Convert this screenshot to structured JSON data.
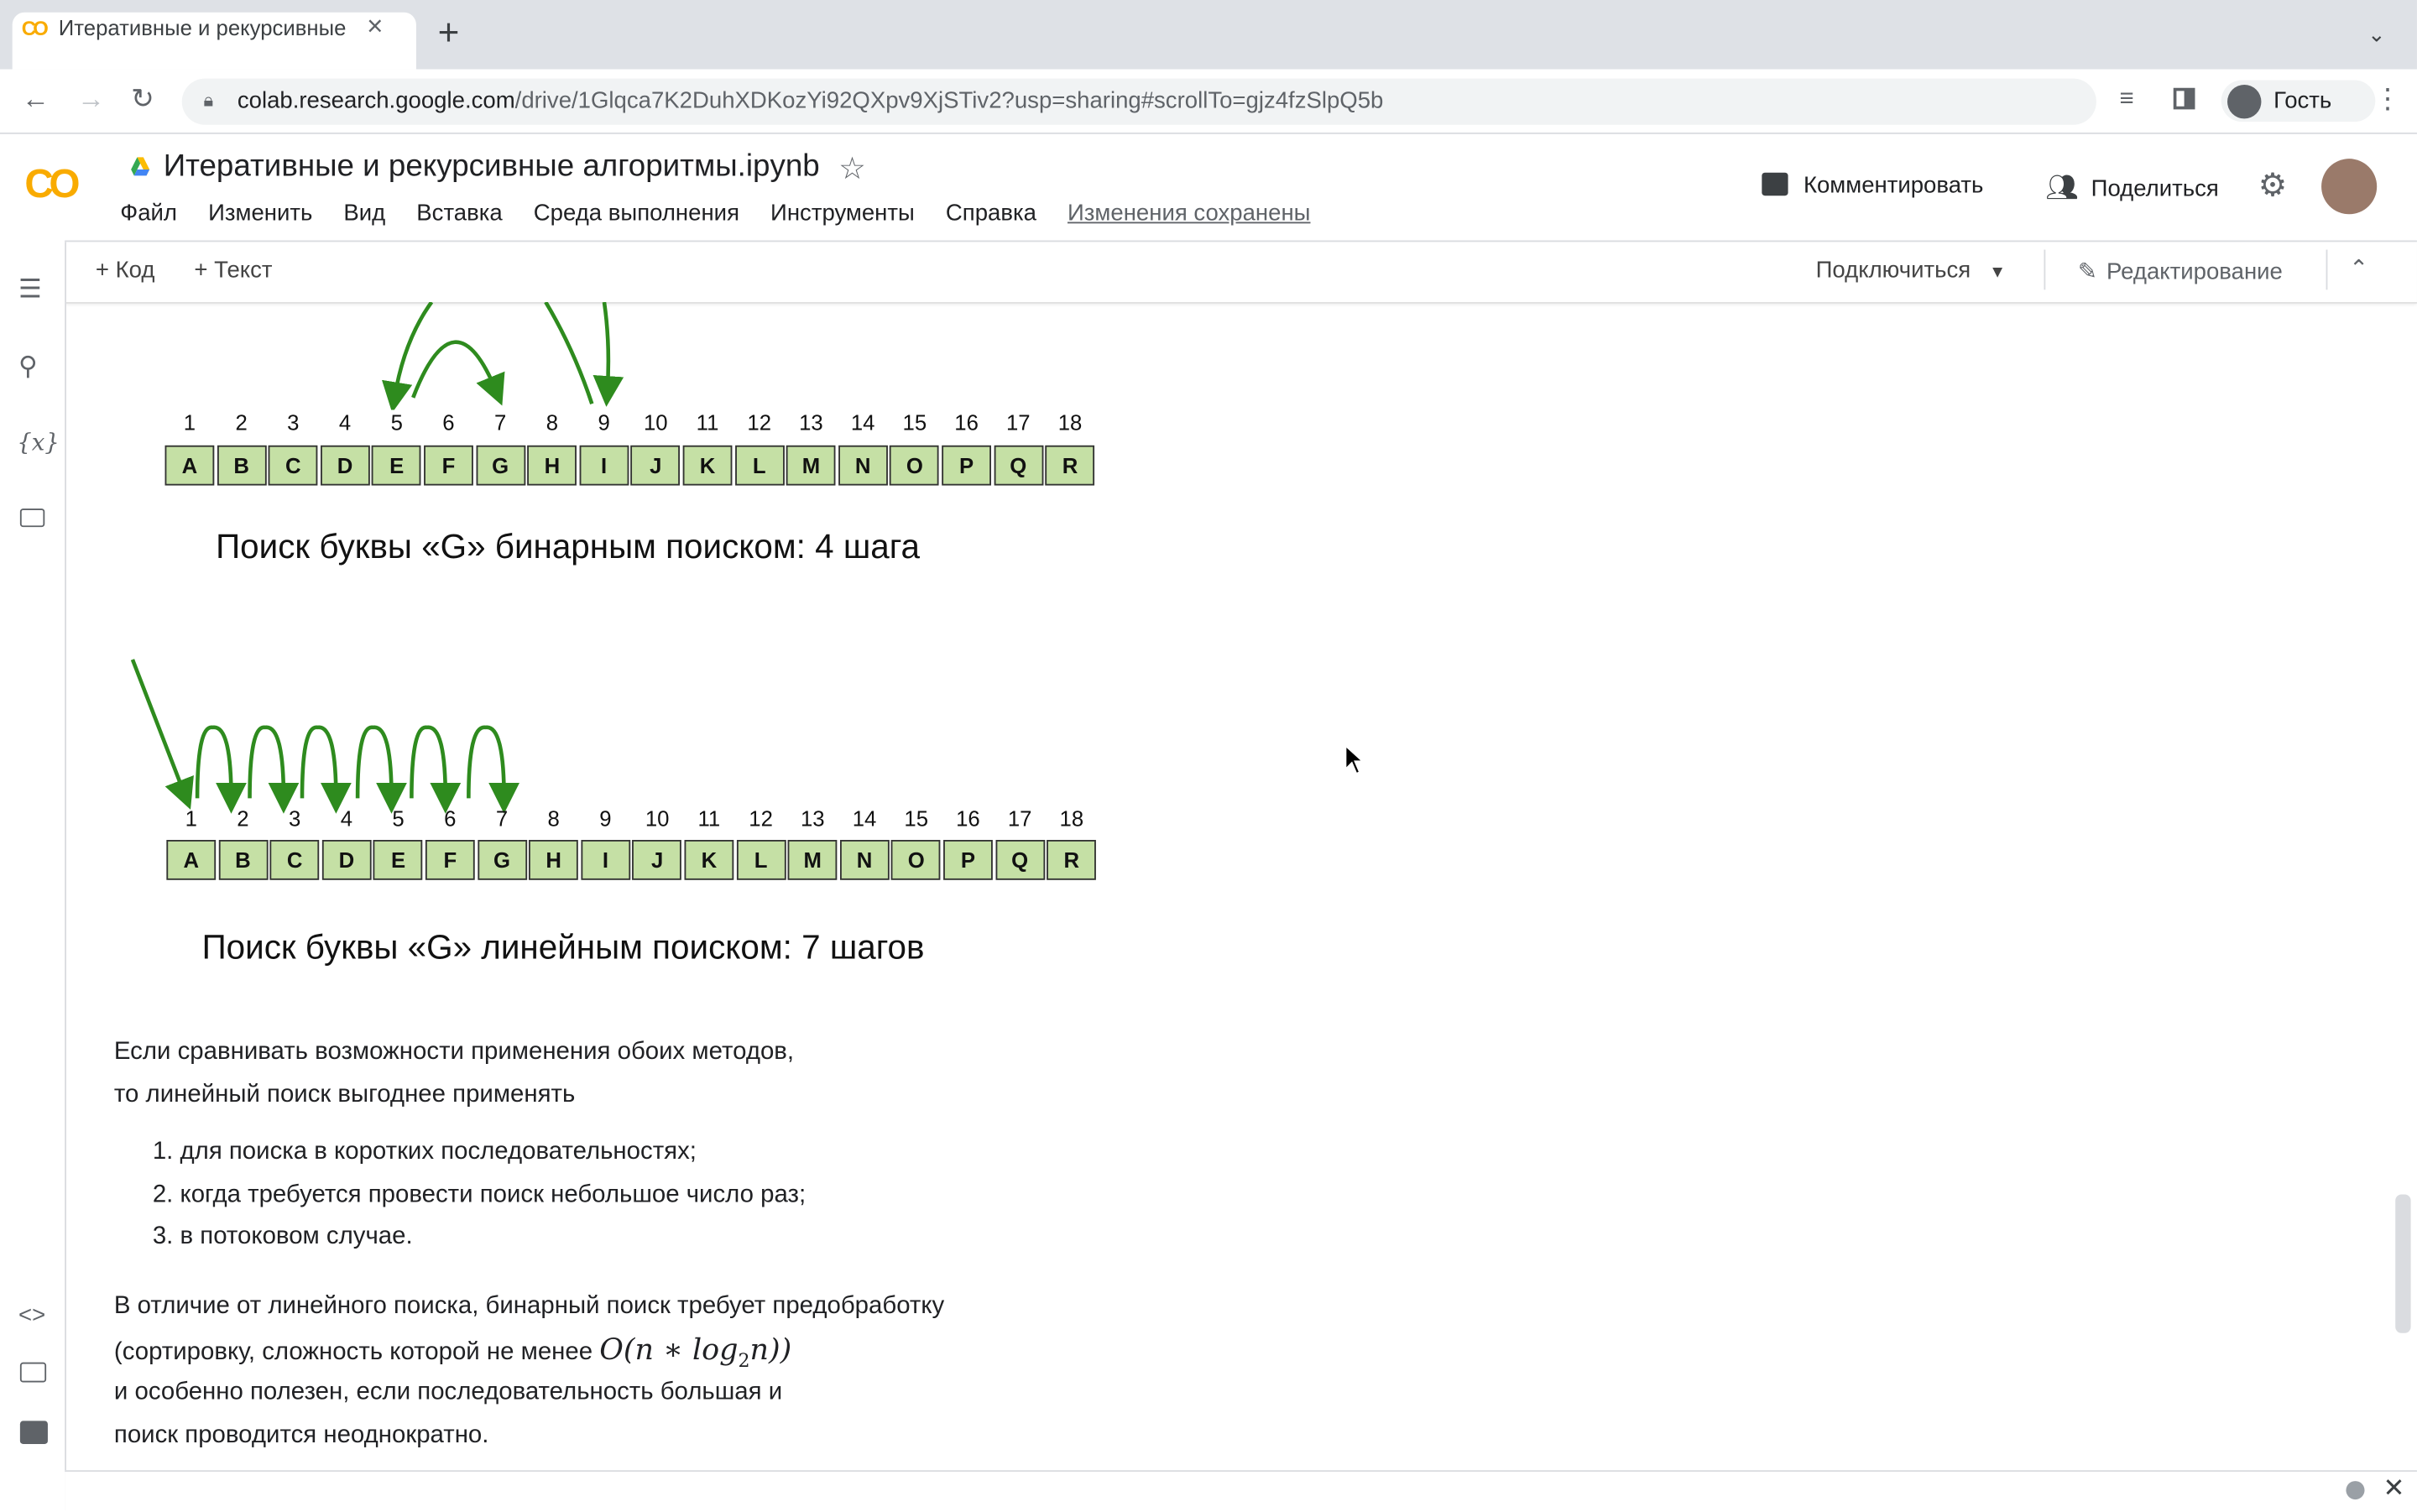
{
  "browser": {
    "tab_title": "Итеративные и рекурсивные",
    "url_host": "colab.research.google.com",
    "url_path": "/drive/1Glqca7K2DuhXDKozYi92QXpv9XjSTiv2?usp=sharing#scrollTo=gjz4fzSlpQ5b",
    "guest_label": "Гость"
  },
  "colab": {
    "logo": "CO",
    "notebook_title": "Итеративные и рекурсивные алгоритмы.ipynb",
    "menu": [
      "Файл",
      "Изменить",
      "Вид",
      "Вставка",
      "Среда выполнения",
      "Инструменты",
      "Справка"
    ],
    "saved_status": "Изменения сохранены",
    "comment_label": "Комментировать",
    "share_label": "Поделиться",
    "add_code": "+ Код",
    "add_text": "+ Текст",
    "connect_label": "Подключиться",
    "edit_label": "Редактирование"
  },
  "figures": {
    "numbers": [
      "1",
      "2",
      "3",
      "4",
      "5",
      "6",
      "7",
      "8",
      "9",
      "10",
      "11",
      "12",
      "13",
      "14",
      "15",
      "16",
      "17",
      "18"
    ],
    "letters": [
      "A",
      "B",
      "C",
      "D",
      "E",
      "F",
      "G",
      "H",
      "I",
      "J",
      "K",
      "L",
      "M",
      "N",
      "O",
      "P",
      "Q",
      "R"
    ],
    "binary_caption": "Поиск буквы «G» бинарным поиском: 4 шага",
    "linear_caption": "Поиск буквы «G» линейным поиском: 7 шагов",
    "colors": {
      "cell_fill": "#c5e0a5",
      "arrow": "#2e8b1e"
    }
  },
  "text": {
    "intro_line1": "Если сравнивать возможности применения обоих методов,",
    "intro_line2": "то линейный поиск выгоднее применять",
    "list": [
      "для поиска в коротких последовательностях;",
      "когда требуется провести поиск небольшое число раз;",
      "в потоковом случае."
    ],
    "list_markers": [
      "1.",
      "2.",
      "3."
    ],
    "p2_line1": "В отличие от линейного поиска, бинарный поиск требует предобработку",
    "p2_line2": "(сортировку, сложность которой не менее",
    "formula_O": "O",
    "formula_n": "n",
    "formula_star": "∗",
    "formula_log": "log",
    "formula_sub": "2",
    "p2_line3": "и особенно полезен, если последовательность большая и",
    "p2_line4": "поиск проводится неоднократно."
  }
}
